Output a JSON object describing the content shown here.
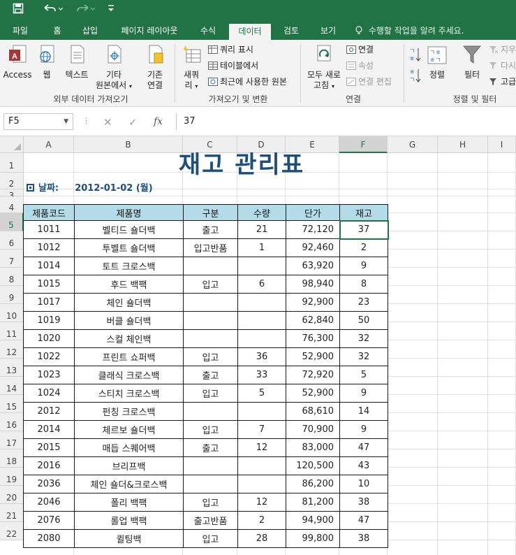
{
  "quick_access": {
    "save_icon": "save-icon",
    "undo_icon": "undo-icon",
    "redo_icon": "redo-icon",
    "customize_icon": "customize-qat-icon"
  },
  "tabs": [
    {
      "label": "파일"
    },
    {
      "label": "홈"
    },
    {
      "label": "삽입"
    },
    {
      "label": "페이지 레이아웃"
    },
    {
      "label": "수식"
    },
    {
      "label": "데이터",
      "active": true
    },
    {
      "label": "검토"
    },
    {
      "label": "보기"
    }
  ],
  "tell_me": "수행할 작업을 알려 주세요.",
  "ribbon": {
    "group_external": {
      "label": "외부 데이터 가져오기",
      "access": "Access",
      "web": "웹",
      "text": "텍스트",
      "other_1": "기타",
      "other_2": "원본에서",
      "existing_1": "기존",
      "existing_2": "연결"
    },
    "group_get": {
      "label": "가져오기 및 변환",
      "new_query_1": "새쿼",
      "new_query_2": "리",
      "show_query": "쿼리 표시",
      "from_table": "테이블에서",
      "recent": "최근에 사용한 원본"
    },
    "group_connections": {
      "label": "연결",
      "refresh_1": "모두 새로",
      "refresh_2": "고침",
      "connections": "연결",
      "properties": "속성",
      "edit_links": "연결 편집"
    },
    "group_sort": {
      "label": "정렬 및 필터",
      "sort": "정렬",
      "filter": "필터",
      "clear": "지우",
      "reapply": "다시",
      "advanced": "고급"
    }
  },
  "formula_bar": {
    "name_box": "F5",
    "fx": "fx",
    "content": "37"
  },
  "columns": [
    "A",
    "B",
    "C",
    "D",
    "E",
    "F",
    "G",
    "H",
    "I"
  ],
  "selected_column": "F",
  "rows": [
    "1",
    "2",
    "3",
    "4",
    "5",
    "6",
    "7",
    "8",
    "9",
    "10",
    "11",
    "12",
    "13",
    "14",
    "15",
    "16",
    "17",
    "18",
    "19",
    "20",
    "21",
    "22"
  ],
  "selected_row": "5",
  "sheet": {
    "title": "재고 관리표",
    "date_label": "날짜:",
    "date_value": "2012-01-02 (월)",
    "headers": [
      "제품코드",
      "제품명",
      "구분",
      "수량",
      "단가",
      "재고"
    ],
    "records": [
      [
        "1011",
        "벨티드 숄더백",
        "출고",
        "21",
        "72,120",
        "37"
      ],
      [
        "1012",
        "투벨트 숄더백",
        "입고반품",
        "1",
        "92,460",
        "2"
      ],
      [
        "1014",
        "토트 크로스백",
        "",
        "",
        "63,920",
        "9"
      ],
      [
        "1015",
        "후드 백팩",
        "입고",
        "6",
        "98,940",
        "8"
      ],
      [
        "1017",
        "체인 숄더백",
        "",
        "",
        "92,900",
        "23"
      ],
      [
        "1019",
        "버클 숄더백",
        "",
        "",
        "62,840",
        "50"
      ],
      [
        "1020",
        "스컬 체인백",
        "",
        "",
        "76,300",
        "32"
      ],
      [
        "1022",
        "프린트 쇼퍼백",
        "입고",
        "36",
        "52,900",
        "32"
      ],
      [
        "1023",
        "클래식 크로스백",
        "출고",
        "33",
        "72,920",
        "5"
      ],
      [
        "1024",
        "스티치 크로스백",
        "입고",
        "5",
        "52,900",
        "9"
      ],
      [
        "2012",
        "펀칭 크로스백",
        "",
        "",
        "68,610",
        "14"
      ],
      [
        "2014",
        "체르보 숄더백",
        "입고",
        "7",
        "70,900",
        "9"
      ],
      [
        "2015",
        "매듭 스퀘어백",
        "출고",
        "12",
        "83,000",
        "47"
      ],
      [
        "2016",
        "브리프백",
        "",
        "",
        "120,500",
        "43"
      ],
      [
        "2036",
        "체인 숄더&크로스백",
        "",
        "",
        "86,200",
        "10"
      ],
      [
        "2046",
        "폴리 백팩",
        "입고",
        "12",
        "81,200",
        "38"
      ],
      [
        "2076",
        "롤업 백팩",
        "출고반품",
        "2",
        "94,900",
        "47"
      ],
      [
        "2080",
        "퀼팅백",
        "입고",
        "28",
        "99,800",
        "38"
      ]
    ]
  },
  "colors": {
    "accent": "#217346",
    "title": "#1f4e79",
    "header_fill": "#b4dce8"
  }
}
